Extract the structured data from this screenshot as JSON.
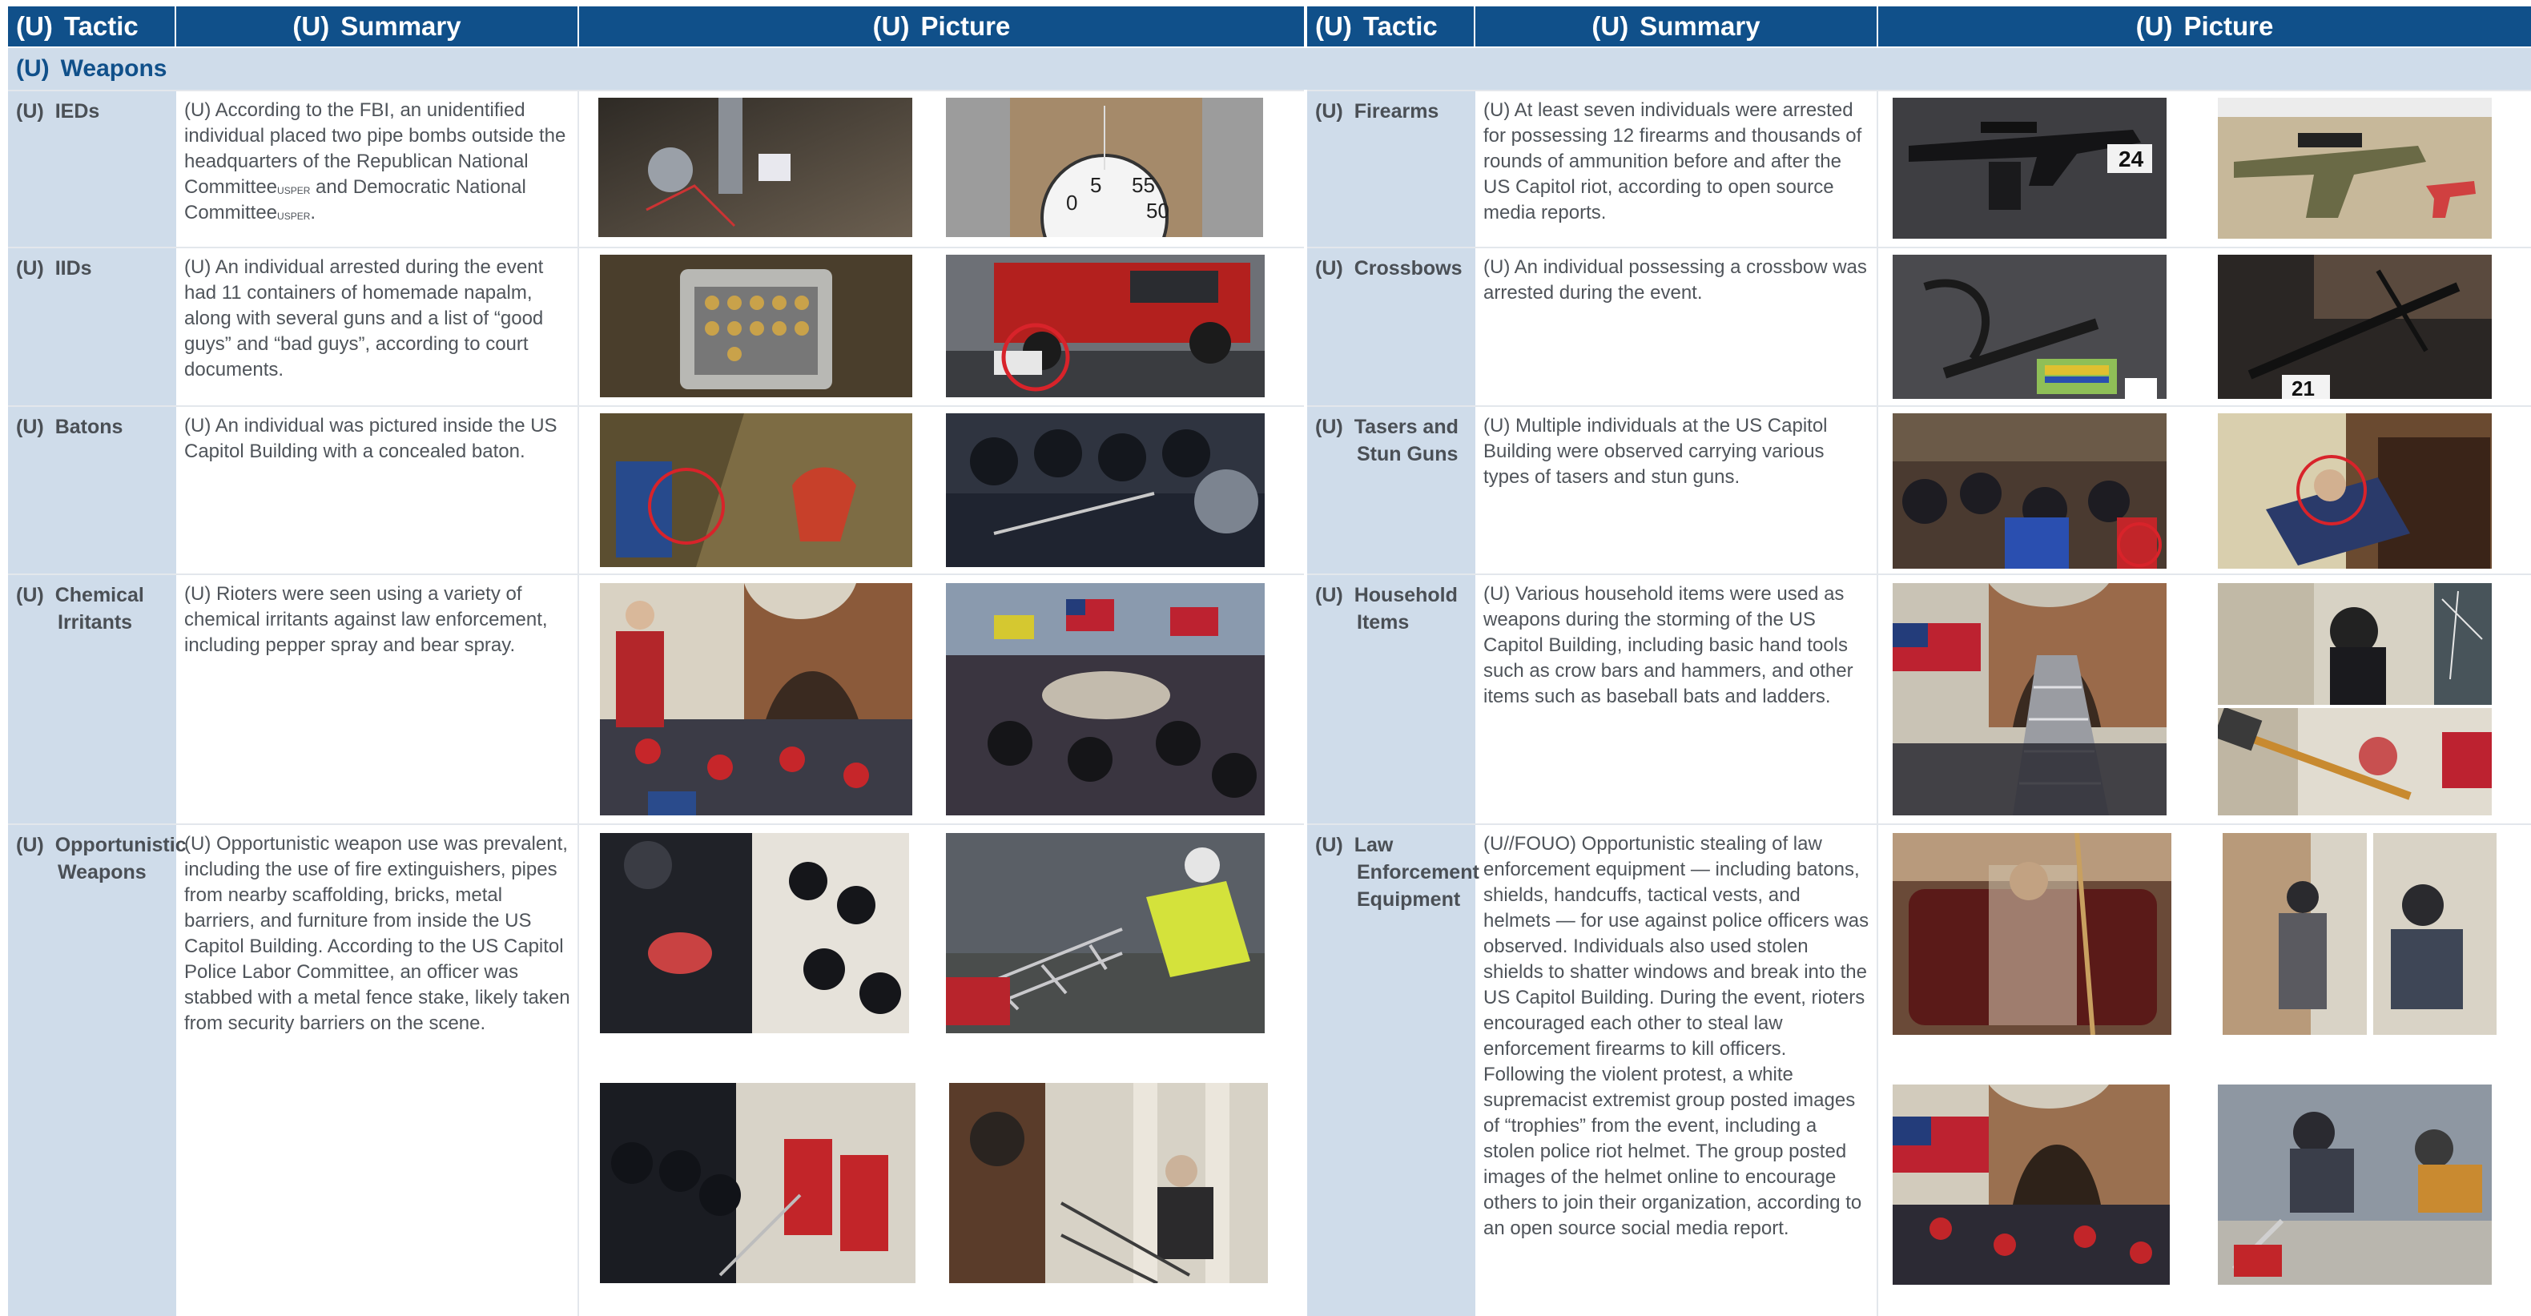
{
  "header": {
    "marking": "(U)",
    "col_tactic": "Tactic",
    "col_summary": "Summary",
    "col_picture": "Picture"
  },
  "section": {
    "marking": "(U)",
    "title": "Weapons"
  },
  "rows_left": [
    {
      "tactic_mark": "(U)",
      "tactic": [
        "IEDs"
      ],
      "summary_before": "(U)  According to the FBI, an unidentified individual placed two pipe bombs outside the headquarters of the Republican National Committee",
      "sup1": "USPER",
      "summary_mid": " and Democratic National Committee",
      "sup2": "USPER",
      "summary_after": "."
    },
    {
      "tactic_mark": "(U)",
      "tactic": [
        "IIDs"
      ],
      "summary": "(U)  An individual arrested during the event had 11 containers of homemade napalm, along with several guns and a list of “good guys” and “bad guys”, according to court documents."
    },
    {
      "tactic_mark": "(U)",
      "tactic": [
        "Batons"
      ],
      "summary": "(U)  An individual was pictured inside the US Capitol Building with a concealed baton."
    },
    {
      "tactic_mark": "(U)",
      "tactic": [
        "Chemical",
        "Irritants"
      ],
      "summary": "(U)  Rioters were seen using a variety of chemical irritants against law enforcement, including pepper spray and bear spray."
    },
    {
      "tactic_mark": "(U)",
      "tactic": [
        "Opportunistic",
        "Weapons"
      ],
      "summary": "(U)  Opportunistic weapon use was prevalent, including the use of fire extinguishers, pipes from nearby scaffolding, bricks, metal barriers, and furniture from inside the US Capitol Building. According to the US Capitol Police Labor Committee, an officer was stabbed with a metal fence stake, likely taken from security barriers on the scene."
    }
  ],
  "rows_right": [
    {
      "tactic_mark": "(U)",
      "tactic": [
        "Firearms"
      ],
      "summary": "(U)  At least seven individuals were arrested for possessing 12 firearms and thousands of rounds of ammunition before and after the US Capitol riot, according to open source media reports."
    },
    {
      "tactic_mark": "(U)",
      "tactic": [
        "Crossbows"
      ],
      "summary": "(U)  An individual possessing a crossbow was arrested during the event."
    },
    {
      "tactic_mark": "(U)",
      "tactic": [
        "Tasers and",
        "Stun Guns"
      ],
      "summary": "(U)  Multiple individuals at the US Capitol Building were observed carrying various types of tasers and stun guns."
    },
    {
      "tactic_mark": "(U)",
      "tactic": [
        "Household",
        "Items"
      ],
      "summary": "(U)  Various household items were used as weapons during the storming of the US Capitol Building, including basic hand tools such as crow bars and hammers, and other items such as baseball bats and ladders."
    },
    {
      "tactic_mark": "(U)",
      "tactic": [
        "Law",
        "Enforcement",
        "Equipment"
      ],
      "summary": "(U//FOUO)  Opportunistic stealing of law enforcement equipment — including batons, shields, handcuffs, tactical vests, and helmets — for use against police officers was observed. Individuals also used stolen shields to shatter windows and break into the US Capitol Building. During the event, rioters encouraged each other to steal law enforcement firearms to kill officers. Following the violent protest, a white supremacist extremist group posted images of “trophies” from the event, including a stolen police riot helmet. The group posted images of the helmet online to encourage others to join their organization, according to an open source social media report."
    }
  ],
  "photo_labels": {
    "evidence_24": "24",
    "evidence_21": "21"
  },
  "colors": {
    "header": "#10508a",
    "tactic_bg": "#cfdcea",
    "text": "#4a4f55",
    "circle": "#d8232a"
  }
}
